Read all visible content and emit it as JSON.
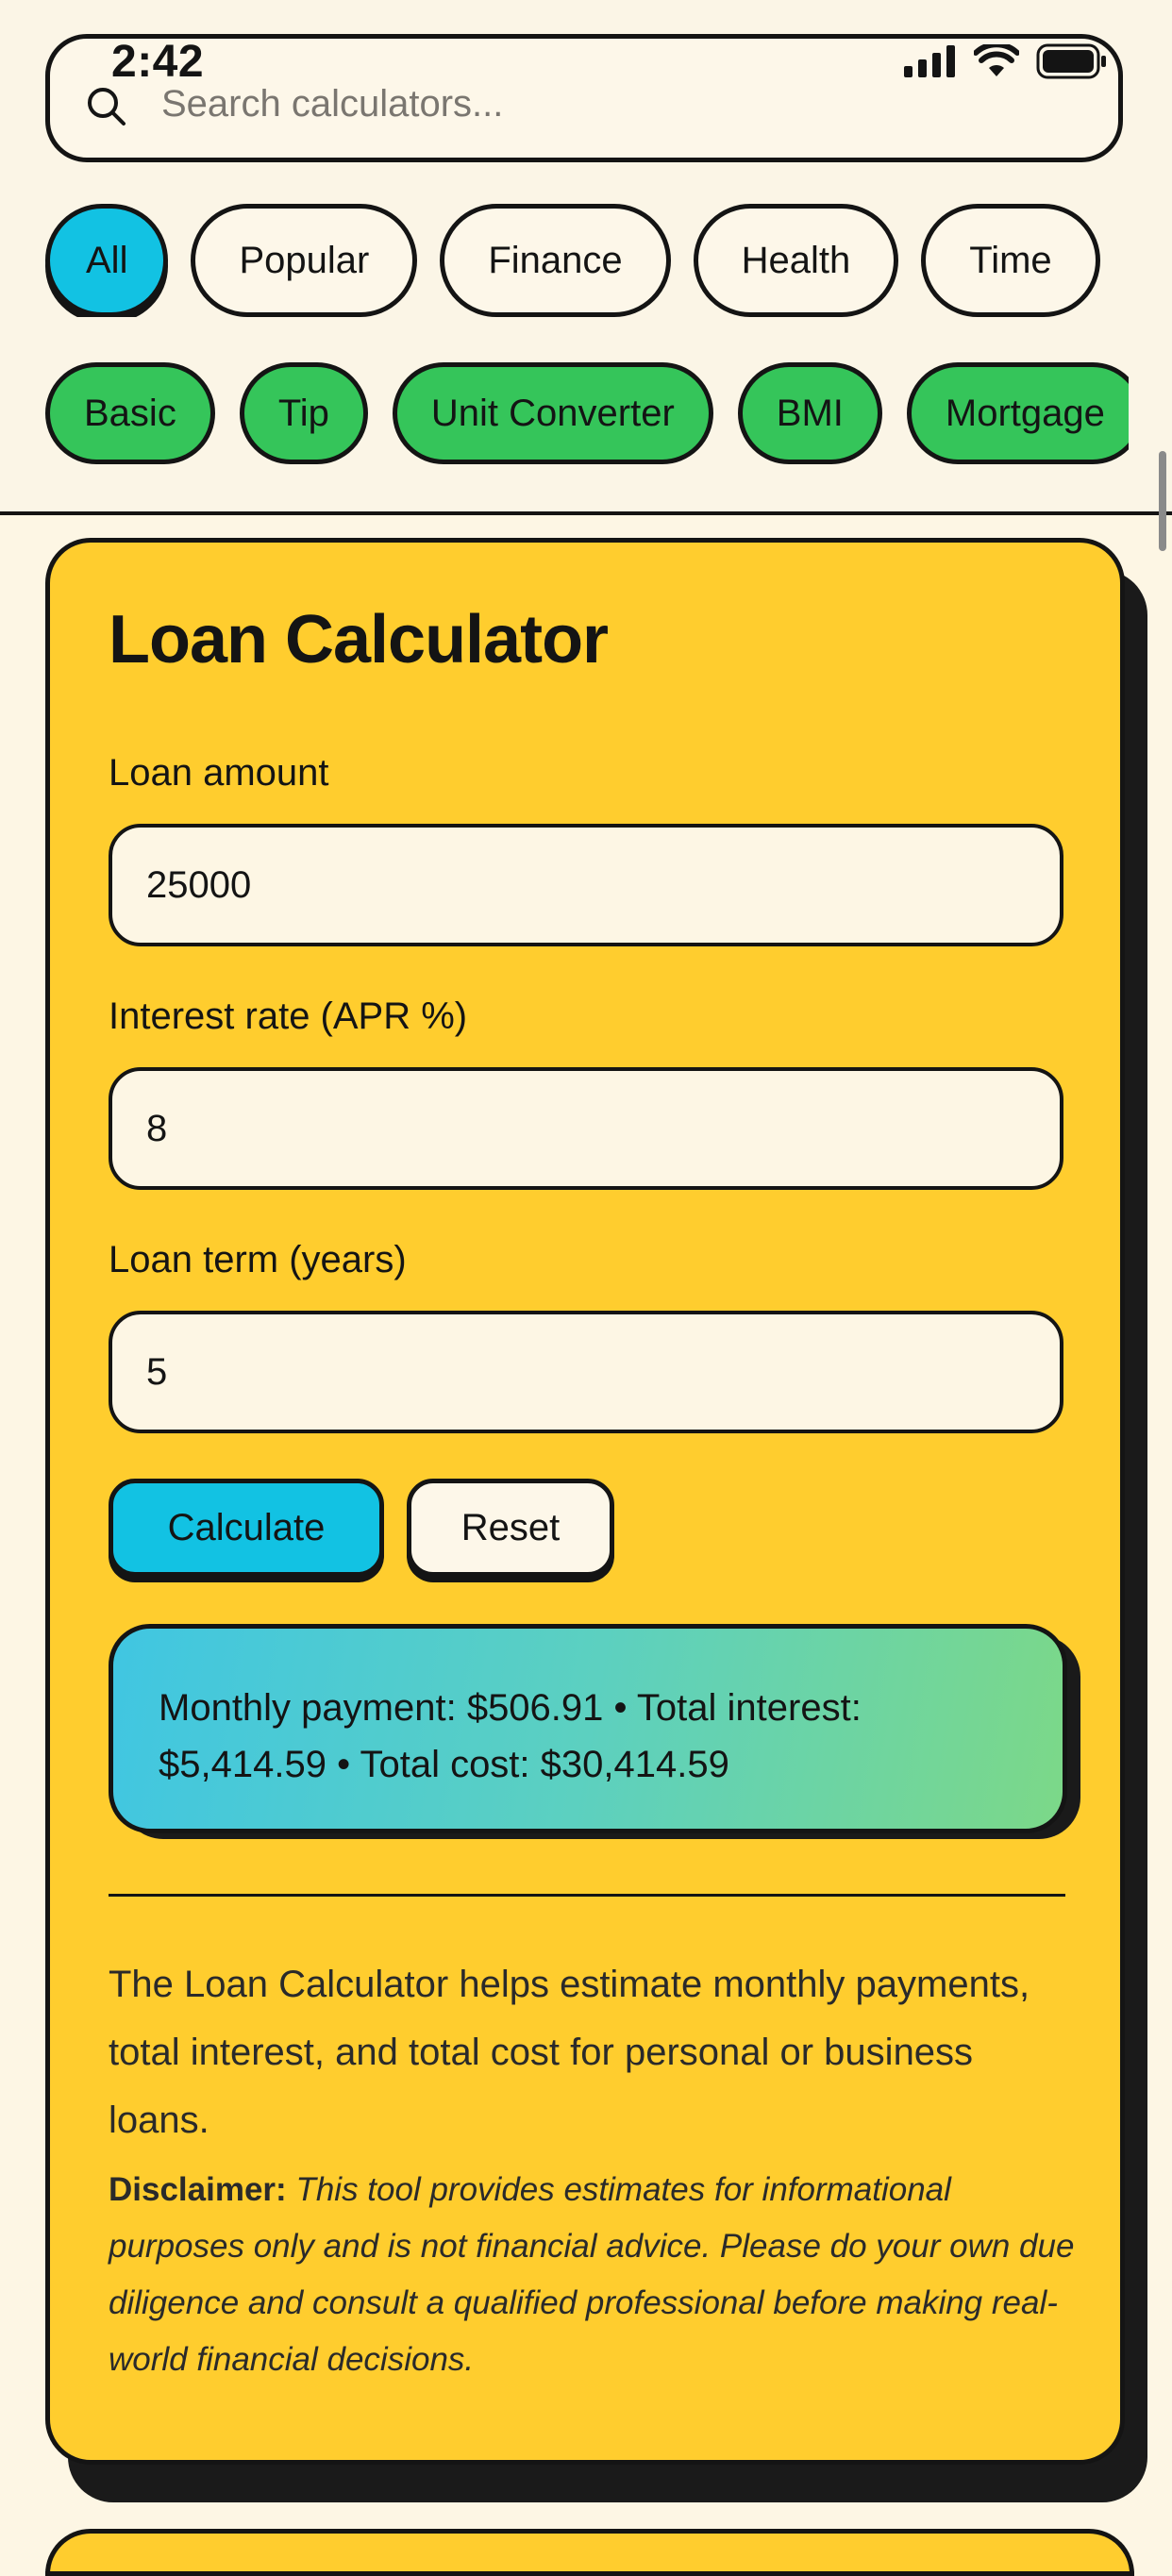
{
  "status_bar": {
    "time": "2:42"
  },
  "search": {
    "placeholder": "Search calculators..."
  },
  "category_chips": [
    "All",
    "Popular",
    "Finance",
    "Health",
    "Time"
  ],
  "tool_chips": [
    "Basic",
    "Tip",
    "Unit Converter",
    "BMI",
    "Mortgage"
  ],
  "calculator": {
    "title": "Loan Calculator",
    "fields": [
      {
        "label": "Loan amount",
        "value": "25000"
      },
      {
        "label": "Interest rate (APR %)",
        "value": "8"
      },
      {
        "label": "Loan term (years)",
        "value": "5"
      }
    ],
    "calculate_label": "Calculate",
    "reset_label": "Reset",
    "result": "Monthly payment: $506.91 • Total interest: $5,414.59 • Total cost: $30,414.59",
    "description": "The Loan Calculator helps estimate monthly payments, total interest, and total cost for personal or business loans.",
    "disclaimer_label": "Disclaimer:",
    "disclaimer_text": "This tool provides estimates for informational purposes only and is not financial advice. Please do your own due diligence and consult a qualified professional before making real-world financial decisions."
  },
  "colors": {
    "background": "#fdf6e4",
    "card": "#ffcd2e",
    "accent_blue": "#12c2e3",
    "chip_green": "#35c55a",
    "border": "#141414"
  }
}
